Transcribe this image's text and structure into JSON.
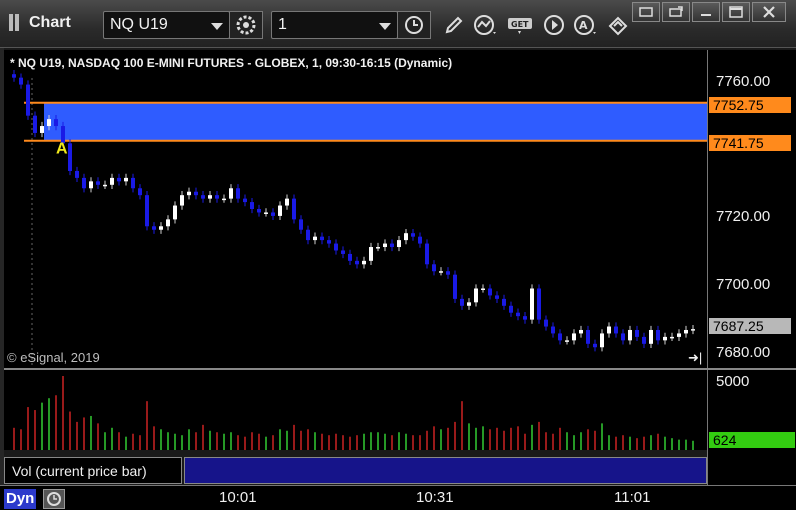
{
  "window": {
    "title": "Chart",
    "symbol": "NQ U19",
    "interval": "1"
  },
  "chart": {
    "header": "* NQ U19, NASDAQ 100 E-MINI FUTURES - GLOBEX, 1, 09:30-16:15 (Dynamic)",
    "copyright": "© eSignal, 2019",
    "marker_label": "A",
    "colors": {
      "zone_fill": "#2f5cff",
      "zone_line": "#ff8a1c",
      "up_candle": "#ffffff",
      "down_candle": "#1a1ae6",
      "vol_up": "#33cc33",
      "vol_down": "#cc2222",
      "badge_price": "#b8b8b8",
      "badge_zone": "#ff8a1c",
      "badge_vol": "#33cc11"
    }
  },
  "price_axis": {
    "ticks": [
      "7760.00",
      "7740.00",
      "7720.00",
      "7700.00",
      "7680.00"
    ],
    "zone_upper": "7752.75",
    "zone_lower": "7741.75",
    "last_price": "7687.25"
  },
  "volume_axis": {
    "max_label": "5000",
    "current_volume": "624"
  },
  "study": {
    "label": "Vol (current price bar)",
    "close_glyph": "×"
  },
  "time_axis": {
    "mode": "Dyn",
    "labels": [
      "10:01",
      "10:31",
      "11:01"
    ]
  },
  "chart_data": {
    "type": "candlestick",
    "symbol": "NQ U19",
    "y_range": [
      7676,
      7768
    ],
    "zone": {
      "upper": 7752.75,
      "lower": 7741.75
    },
    "last_price": 7687.25,
    "closes": [
      7760,
      7758,
      7749,
      7744,
      7746,
      7748,
      7746,
      7741,
      7733,
      7731,
      7728,
      7730,
      7729,
      7729,
      7731,
      7730,
      7731,
      7728,
      7726,
      7717,
      7716,
      7717,
      7719,
      7723,
      7726,
      7727,
      7726,
      7725,
      7726,
      7725,
      7725,
      7728,
      7725,
      7724,
      7722,
      7721,
      7721,
      7720,
      7723,
      7725,
      7719,
      7716,
      7713,
      7714,
      7713,
      7712,
      7710,
      7709,
      7707,
      7706,
      7707,
      7711,
      7711,
      7712,
      7711,
      7713,
      7715,
      7714,
      7712,
      7706,
      7704,
      7704,
      7703,
      7696,
      7694,
      7695,
      7699,
      7699,
      7697,
      7696,
      7694,
      7692,
      7691,
      7690,
      7699,
      7690,
      7688,
      7686,
      7684,
      7684,
      7686,
      7687,
      7683,
      7682,
      7686,
      7688,
      7686,
      7684,
      7687,
      7685,
      7683,
      7687,
      7684,
      7685,
      7685,
      7686,
      7687,
      7687.25
    ],
    "volume": [
      1500,
      1400,
      2900,
      2700,
      3200,
      3500,
      3700,
      5000,
      2600,
      1900,
      2200,
      2300,
      1800,
      1200,
      1500,
      1200,
      900,
      1100,
      1000,
      3300,
      1600,
      1400,
      1200,
      1100,
      1000,
      1400,
      1200,
      1700,
      1300,
      1200,
      1100,
      1200,
      1000,
      900,
      1200,
      1100,
      900,
      1000,
      1400,
      1300,
      1700,
      1300,
      1400,
      1200,
      1100,
      1000,
      1100,
      1000,
      900,
      1000,
      1100,
      1200,
      1200,
      1100,
      1000,
      1200,
      1100,
      1000,
      1000,
      1300,
      1600,
      1400,
      1500,
      1900,
      3300,
      1800,
      1500,
      1600,
      1400,
      1500,
      1300,
      1500,
      1600,
      1100,
      1700,
      1900,
      1200,
      1100,
      1500,
      1200,
      1000,
      1200,
      1400,
      1300,
      1800,
      1000,
      900,
      1000,
      900,
      800,
      900,
      1000,
      1100,
      900,
      800,
      700,
      700,
      624
    ],
    "volume_range": [
      0,
      5000
    ],
    "x_labels": [
      "10:01",
      "10:31",
      "11:01"
    ]
  }
}
